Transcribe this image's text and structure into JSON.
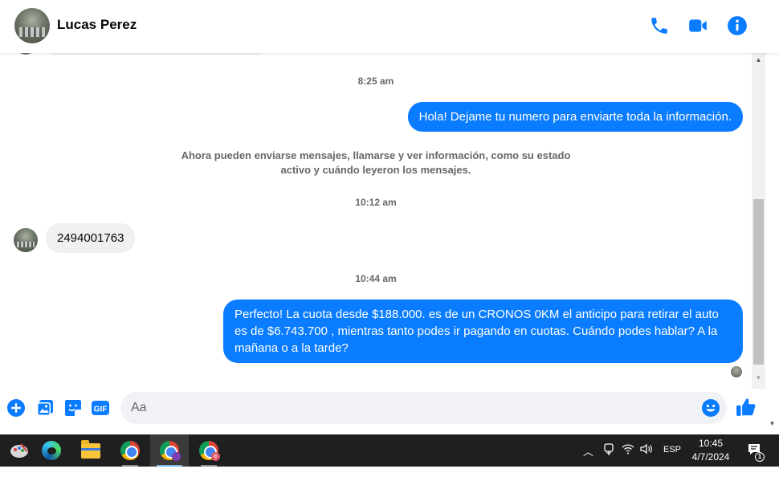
{
  "header": {
    "contact_name": "Lucas Perez",
    "icons": [
      "phone-icon",
      "video-call-icon",
      "info-icon"
    ]
  },
  "conversation": {
    "timestamps": [
      "8:25 am",
      "10:12 am",
      "10:44 am"
    ],
    "messages": [
      {
        "direction": "outgoing",
        "text": "Hola! Dejame tu numero  para enviarte toda la información."
      },
      {
        "direction": "system",
        "text": "Ahora pueden enviarse mensajes, llamarse y ver información, como su estado activo y cuándo leyeron los mensajes."
      },
      {
        "direction": "incoming",
        "text": "2494001763"
      },
      {
        "direction": "outgoing",
        "text": "Perfecto! La cuota desde $188.000. es de un CRONOS 0KM el anticipo para retirar el auto es de $6.743.700 , mientras tanto podes ir pagando en cuotas. Cuándo podes hablar? A la mañana o a la tarde?"
      }
    ]
  },
  "composer": {
    "placeholder": "Aa",
    "value": "",
    "icons": [
      "add-icon",
      "photo-icon",
      "sticker-icon",
      "gif-icon",
      "emoji-icon",
      "like-icon"
    ],
    "gif_label": "GIF"
  },
  "taskbar": {
    "apps": [
      "paint-icon",
      "edge-icon",
      "file-explorer-icon",
      "chrome-icon",
      "chrome-profile-icon",
      "chrome-profile-c-icon"
    ],
    "tray": {
      "language": "ESP",
      "time": "10:45",
      "date": "4/7/2024",
      "notification_count": "1"
    }
  },
  "colors": {
    "accent": "#0a7cff",
    "incoming_bubble": "#f0f0f0",
    "taskbar": "#1f1f1f"
  }
}
